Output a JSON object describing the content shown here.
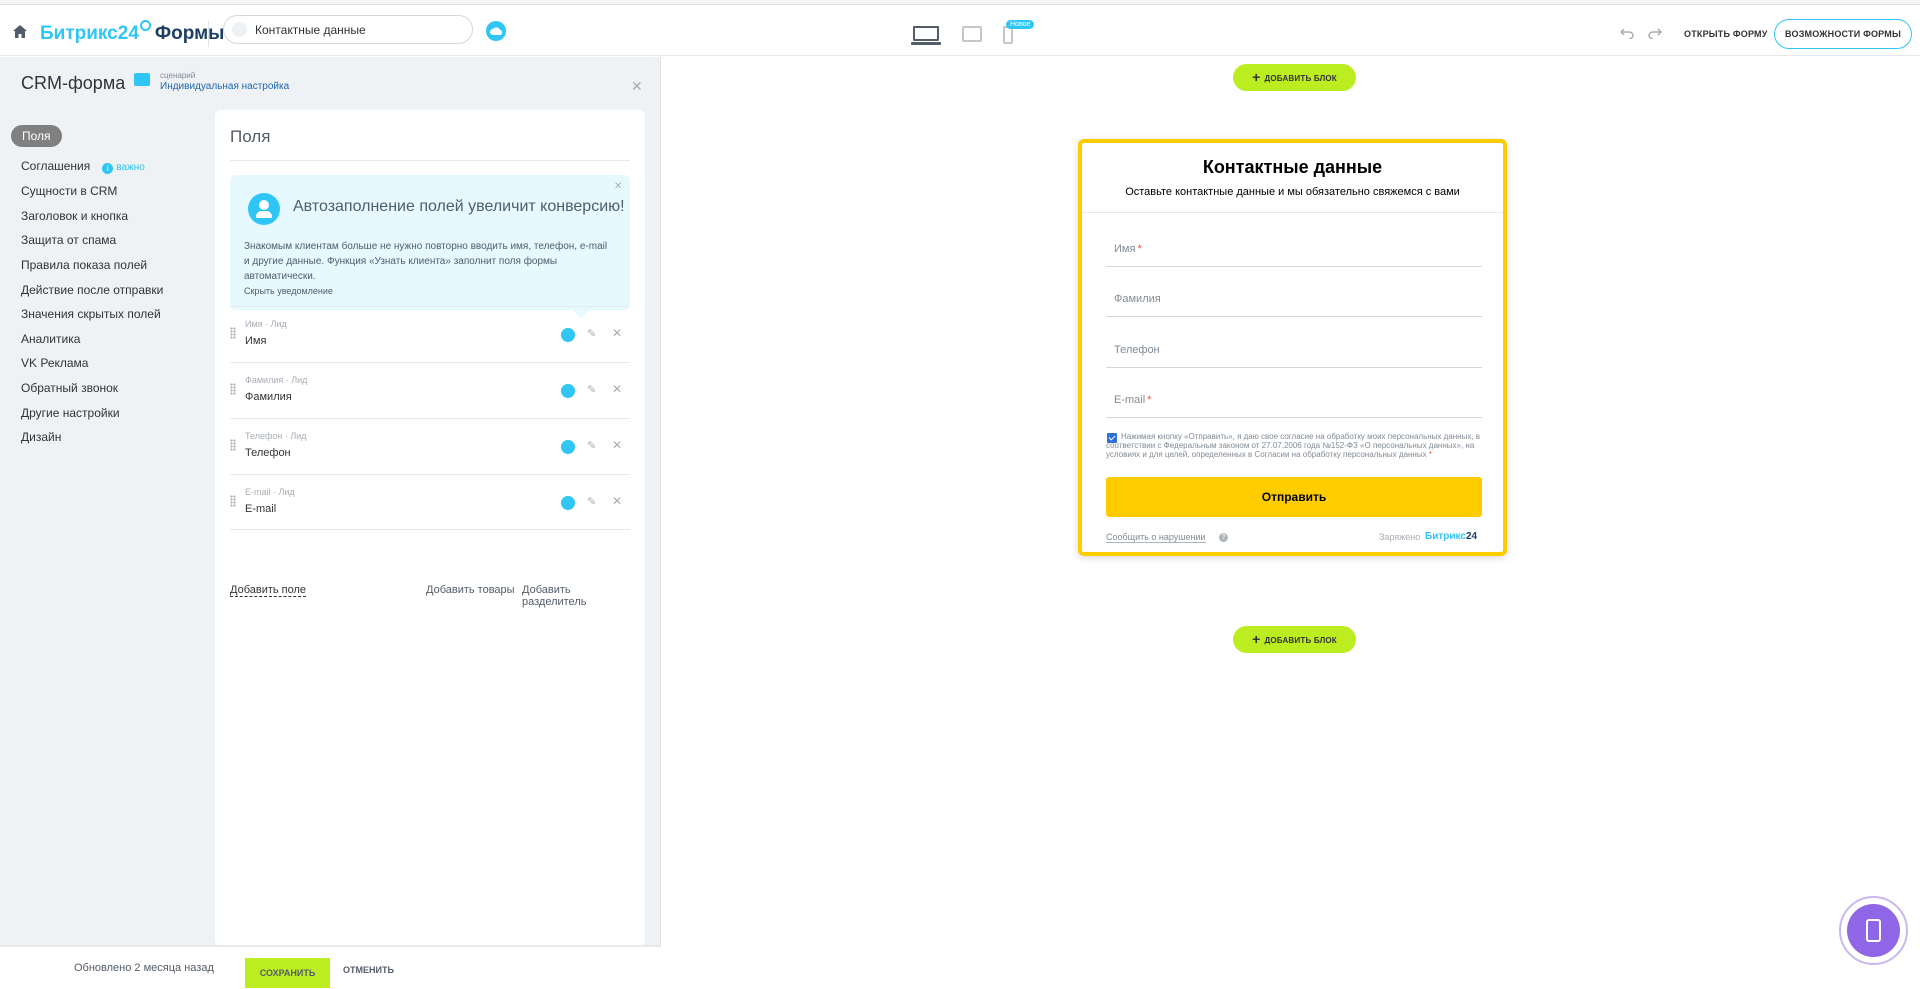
{
  "header": {
    "logo_brand": "Битрикс",
    "logo_num": "24",
    "logo_product": "Формы",
    "search_value": "Контактные данные",
    "new_badge": "Новое",
    "open_form": "ОТКРЫТЬ ФОРМУ",
    "features": "ВОЗМОЖНОСТИ ФОРМЫ"
  },
  "sidebar": {
    "title": "CRM-форма",
    "scenario_label": "сценарий",
    "scenario_value": "Индивидуальная настройка",
    "items": [
      {
        "label": "Поля"
      },
      {
        "label": "Соглашения",
        "badge": "важно"
      },
      {
        "label": "Сущности в CRM"
      },
      {
        "label": "Заголовок и кнопка"
      },
      {
        "label": "Защита от спама"
      },
      {
        "label": "Правила показа полей"
      },
      {
        "label": "Действие после отправки"
      },
      {
        "label": "Значения скрытых полей"
      },
      {
        "label": "Аналитика"
      },
      {
        "label": "VK Реклама"
      },
      {
        "label": "Обратный звонок"
      },
      {
        "label": "Другие настройки"
      },
      {
        "label": "Дизайн"
      }
    ]
  },
  "fields_card": {
    "title": "Поля",
    "hint_title": "Автозаполнение полей увеличит конверсию!",
    "hint_text": "Знакомым клиентам больше не нужно повторно вводить имя, телефон, e-mail и другие данные. Функция «Узнать клиента» заполнит поля формы автоматически.",
    "hint_hide": "Скрыть уведомление",
    "fields": [
      {
        "sub": "Имя · Лид",
        "name": "Имя"
      },
      {
        "sub": "Фамилия · Лид",
        "name": "Фамилия"
      },
      {
        "sub": "Телефон · Лид",
        "name": "Телефон"
      },
      {
        "sub": "E-mail · Лид",
        "name": "E-mail"
      }
    ],
    "add_field": "Добавить поле",
    "add_goods": "Добавить товары",
    "add_separator": "Добавить разделитель"
  },
  "footer": {
    "updated": "Обновлено 2 месяца назад",
    "save": "СОХРАНИТЬ",
    "cancel": "ОТМЕНИТЬ"
  },
  "preview": {
    "add_block": "ДОБАВИТЬ БЛОК",
    "form_title": "Контактные данные",
    "form_subtitle": "Оставьте контактные данные и мы обязательно свяжемся с вами",
    "fields": [
      {
        "label": "Имя",
        "required": "*"
      },
      {
        "label": "Фамилия",
        "required": ""
      },
      {
        "label": "Телефон",
        "required": ""
      },
      {
        "label": "E-mail",
        "required": "*"
      }
    ],
    "consent": "Нажимая кнопку «Отправить», я даю свое согласие на обработку моих персональных данных, в соответствии с Федеральным законом от 27.07.2006 года №152-ФЗ «О персональных данных», на условиях и для целей, определенных в Согласии на обработку персональных данных",
    "consent_required": "*",
    "submit": "Отправить",
    "report": "Сообщить о нарушении",
    "charged": "Заряжено",
    "brand": "Битрикс",
    "brand_num": "24"
  },
  "colors": {
    "accent": "#2fc6f6",
    "save_green": "#bbed21",
    "form_yellow": "#ffcc00",
    "widget_purple": "#8e66e6"
  },
  "icons": [
    "home-icon",
    "cloud-icon",
    "desktop-icon",
    "tablet-icon",
    "mobile-icon",
    "undo-icon",
    "redo-icon",
    "close-icon",
    "user-icon",
    "pencil-icon",
    "drag-icon",
    "phone-icon",
    "plus-icon"
  ]
}
